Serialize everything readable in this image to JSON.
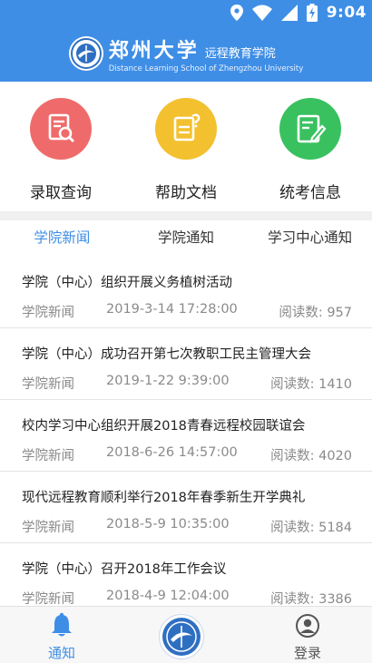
{
  "statusbar": {
    "time": "9:04",
    "icons": [
      "location-icon",
      "wifi-icon",
      "signal-icon",
      "battery-icon"
    ]
  },
  "header": {
    "title_cn": "郑州大学",
    "subtitle_cn": "远程教育学院",
    "title_en": "Distance Learning School of Zhengzhou University",
    "color": "#3f8ee6"
  },
  "quick_links": [
    {
      "label": "录取查询",
      "icon": "search-document-icon",
      "color": "#ef6b6b"
    },
    {
      "label": "帮助文档",
      "icon": "help-document-icon",
      "color": "#f3c02f"
    },
    {
      "label": "统考信息",
      "icon": "exam-edit-icon",
      "color": "#39c15f"
    }
  ],
  "tabs": [
    {
      "label": "学院新闻",
      "active": true
    },
    {
      "label": "学院通知",
      "active": false
    },
    {
      "label": "学习中心通知",
      "active": false
    }
  ],
  "news": [
    {
      "title": "学院（中心）组织开展义务植树活动",
      "category": "学院新闻",
      "date": "2019-3-14 17:28:00",
      "reads": "阅读数: 957"
    },
    {
      "title": "学院（中心）成功召开第七次教职工民主管理大会",
      "category": "学院新闻",
      "date": "2019-1-22 9:39:00",
      "reads": "阅读数: 1410"
    },
    {
      "title": "校内学习中心组织开展2018青春远程校园联谊会",
      "category": "学院新闻",
      "date": "2018-6-26 14:57:00",
      "reads": "阅读数: 4020"
    },
    {
      "title": "现代远程教育顺利举行2018年春季新生开学典礼",
      "category": "学院新闻",
      "date": "2018-5-9 10:35:00",
      "reads": "阅读数: 5184"
    },
    {
      "title": "学院（中心）召开2018年工作会议",
      "category": "学院新闻",
      "date": "2018-4-9 12:04:00",
      "reads": "阅读数: 3386"
    }
  ],
  "bottom_nav": {
    "notify": {
      "label": "通知",
      "color": "#3f8ee6"
    },
    "login": {
      "label": "登录",
      "color": "#555555"
    }
  }
}
